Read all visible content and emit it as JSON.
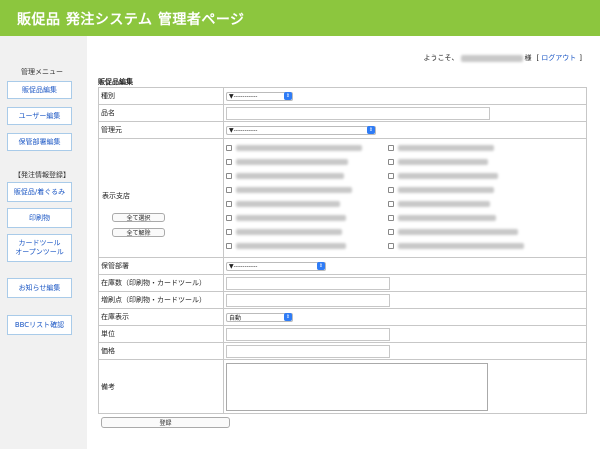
{
  "header": {
    "title": "販促品 発注システム 管理者ページ"
  },
  "welcome": {
    "prefix": "ようこそ、",
    "suffix": "様",
    "logout_label": "ログアウト",
    "bracket_open": "[",
    "bracket_close": "]"
  },
  "sidebar": {
    "menu_heading": "管理メニュー",
    "menu_items": [
      "販促品編集",
      "ユーザー編集",
      "保管部署編集"
    ],
    "order_heading": "【発注情報登録】",
    "order_items": [
      "販促品/着ぐるみ",
      "印刷物",
      "カードツール\nオープンツール"
    ],
    "notice_label": "お知らせ編集",
    "bbc_label": "BBCリスト確認"
  },
  "form": {
    "section_title": "販促品編集",
    "fields": {
      "category": {
        "label": "種別",
        "value": "▼-----------"
      },
      "name": {
        "label": "品名",
        "value": ""
      },
      "manager": {
        "label": "管理元",
        "value": "▼-----------"
      },
      "branches": {
        "label": "表示支店",
        "select_all": "全て選択",
        "deselect_all": "全て解除"
      },
      "storage_dept": {
        "label": "保管部署",
        "value": "▼-----------"
      },
      "stock_qty": {
        "label": "在庫数（印刷物・カードツール）",
        "value": ""
      },
      "reorder_point": {
        "label": "増刷点（印刷物・カードツール）",
        "value": ""
      },
      "stock_display": {
        "label": "在庫表示",
        "value": "自動"
      },
      "unit": {
        "label": "単位",
        "value": ""
      },
      "price": {
        "label": "価格",
        "value": ""
      },
      "remarks": {
        "label": "備考",
        "value": ""
      }
    },
    "submit_label": "登録"
  },
  "colors": {
    "header_bg": "#8cc63e",
    "link": "#1a56c4",
    "select_arrow": "#2f7cf6"
  }
}
